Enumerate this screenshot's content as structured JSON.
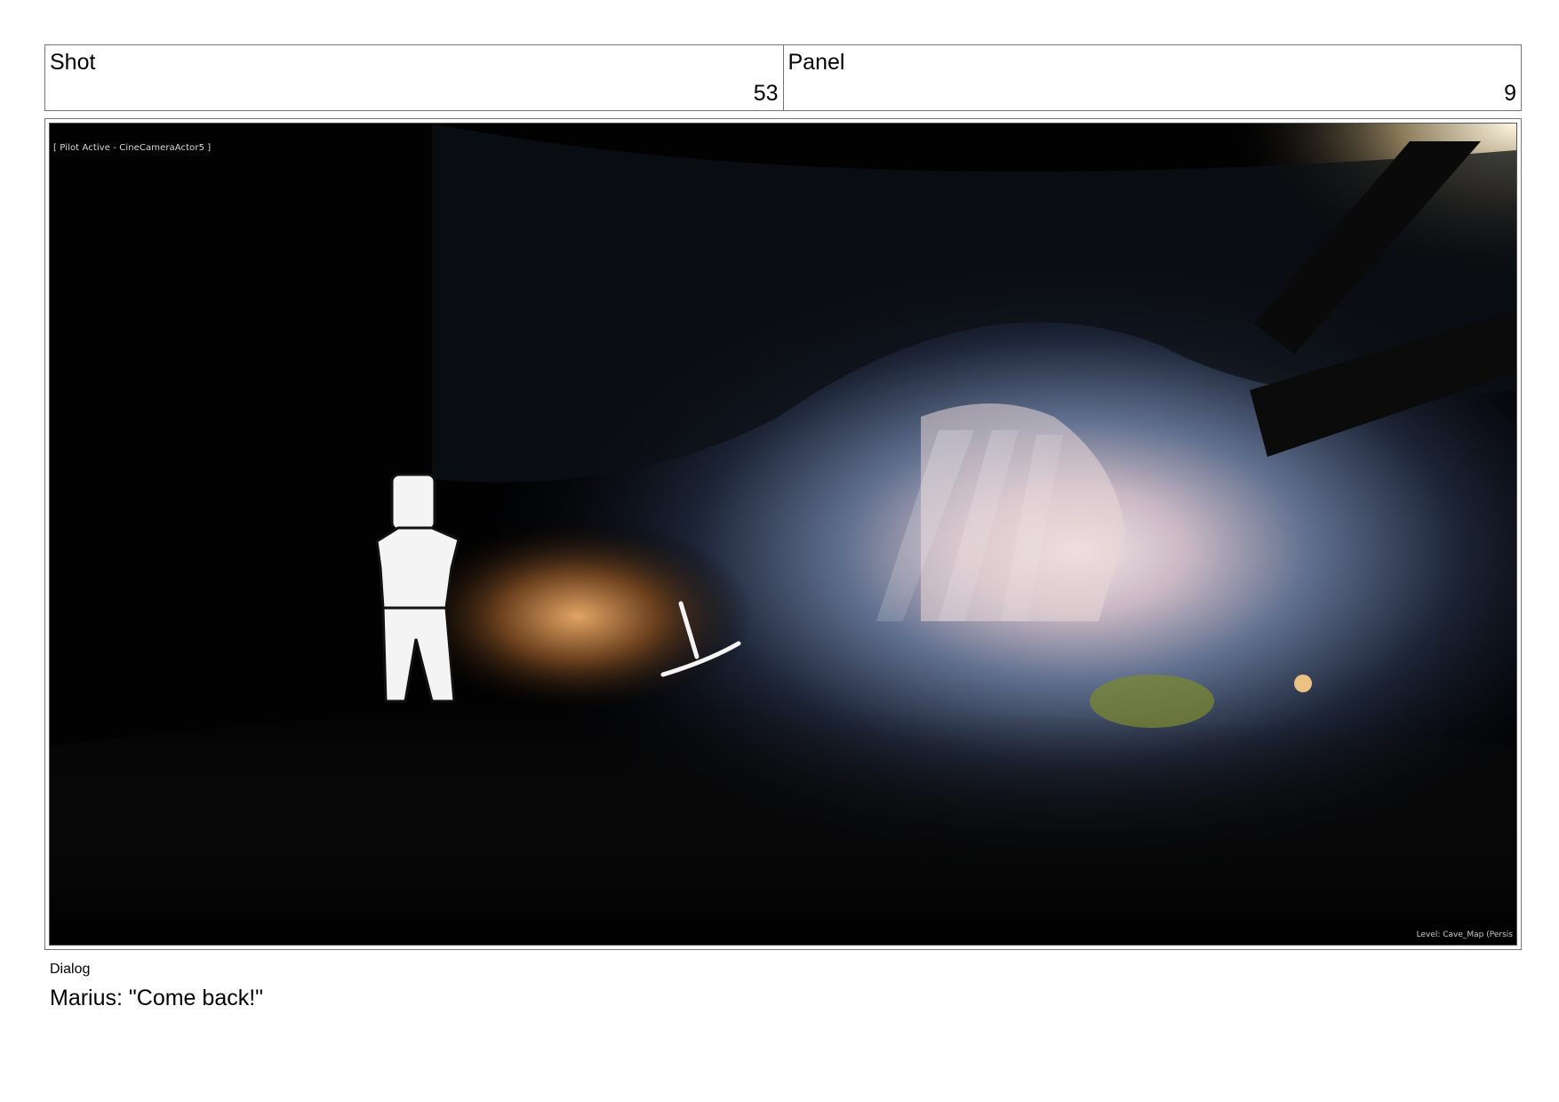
{
  "header": {
    "shot_label": "Shot",
    "shot_number": "53",
    "panel_label": "Panel",
    "panel_number": "9"
  },
  "frame": {
    "hud_top": "[ Pilot Active - CineCameraActor5 ]",
    "hud_bottom": "Level:  Cave_Map (Persis"
  },
  "dialog": {
    "label": "Dialog",
    "text": "Marius: \"Come back!\""
  }
}
